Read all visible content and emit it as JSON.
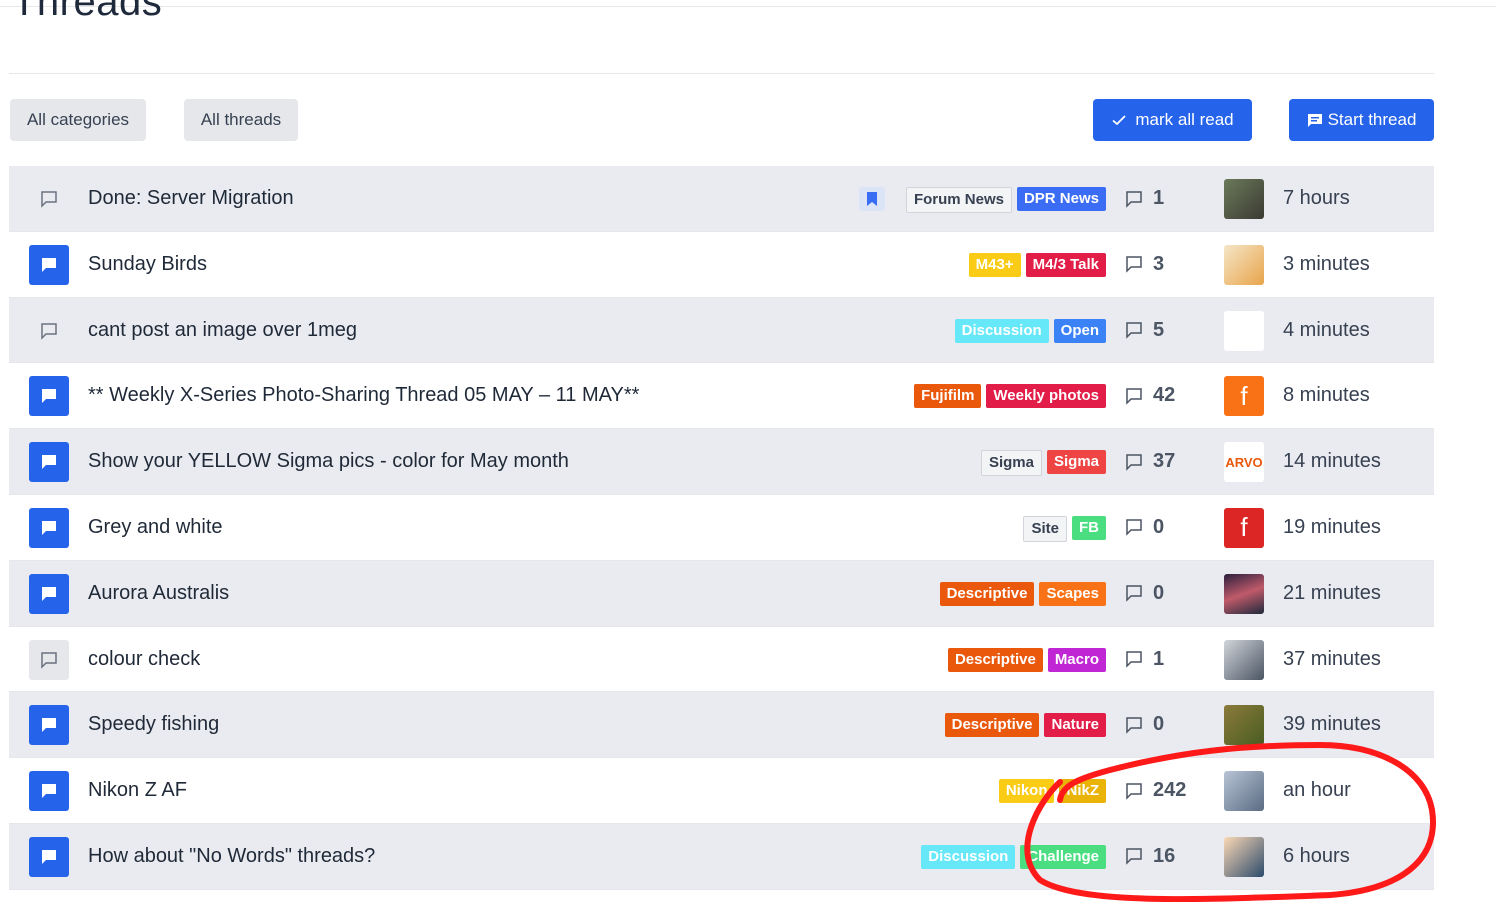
{
  "page": {
    "title": "Threads"
  },
  "toolbar": {
    "all_categories": "All categories",
    "all_threads": "All threads",
    "mark_all_read": "mark all read",
    "start_thread": "Start thread"
  },
  "colors": {
    "accent": "#2563eb",
    "row_alt": "#e9ebf0",
    "annotation": "#ff0000"
  },
  "threads": [
    {
      "title": "Done: Server Migration",
      "icon": "comment-outline-icon",
      "bookmarked": true,
      "tags": [
        {
          "label": "Forum News",
          "bg": "#f3f4f6",
          "fg": "#374151"
        },
        {
          "label": "DPR News",
          "bg": "#3b6cf4",
          "fg": "#ffffff"
        }
      ],
      "replies": "1",
      "avatar": "avatar-photo-man",
      "time": "7 hours"
    },
    {
      "title": "Sunday Birds",
      "icon": "comment-filled-icon",
      "tags": [
        {
          "label": "M43+",
          "bg": "#facc15",
          "fg": "#ffffff"
        },
        {
          "label": "M4/3 Talk",
          "bg": "#e11d48",
          "fg": "#ffffff"
        }
      ],
      "replies": "3",
      "avatar": "avatar-kingfisher",
      "time": "3 minutes"
    },
    {
      "title": "cant post an image over 1meg",
      "icon": "comment-outline-icon",
      "tags": [
        {
          "label": "Discussion",
          "bg": "#67e8f9",
          "fg": "#ffffff"
        },
        {
          "label": "Open",
          "bg": "#3b82f6",
          "fg": "#ffffff"
        }
      ],
      "replies": "5",
      "avatar": "avatar-cartoon-man",
      "time": "4 minutes"
    },
    {
      "title": "** Weekly X-Series Photo-Sharing Thread 05 MAY – 11 MAY**",
      "icon": "comment-filled-icon",
      "tags": [
        {
          "label": "Fujifilm",
          "bg": "#ea580c",
          "fg": "#ffffff"
        },
        {
          "label": "Weekly photos",
          "bg": "#e11d48",
          "fg": "#ffffff"
        }
      ],
      "replies": "42",
      "avatar": "avatar-letter-f-orange",
      "avatar_letter": "f",
      "time": "8 minutes"
    },
    {
      "title": "Show your YELLOW Sigma pics - color for May month",
      "icon": "comment-filled-icon",
      "tags": [
        {
          "label": "Sigma",
          "bg": "#f3f4f6",
          "fg": "#374151"
        },
        {
          "label": "Sigma",
          "bg": "#ef4444",
          "fg": "#ffffff"
        }
      ],
      "replies": "37",
      "avatar": "avatar-arvo",
      "avatar_text": "ARVO",
      "time": "14 minutes"
    },
    {
      "title": "Grey and white",
      "icon": "comment-filled-icon",
      "tags": [
        {
          "label": "Site",
          "bg": "#f3f4f6",
          "fg": "#374151"
        },
        {
          "label": "FB",
          "bg": "#4ade80",
          "fg": "#ffffff"
        }
      ],
      "replies": "0",
      "avatar": "avatar-letter-f-red",
      "avatar_letter": "f",
      "time": "19 minutes"
    },
    {
      "title": "Aurora Australis",
      "icon": "comment-filled-icon",
      "tags": [
        {
          "label": "Descriptive",
          "bg": "#ea580c",
          "fg": "#ffffff"
        },
        {
          "label": "Scapes",
          "bg": "#f97316",
          "fg": "#ffffff"
        }
      ],
      "replies": "0",
      "avatar": "avatar-aurora",
      "time": "21 minutes"
    },
    {
      "title": "colour check",
      "icon": "comment-grey-icon",
      "tags": [
        {
          "label": "Descriptive",
          "bg": "#ea580c",
          "fg": "#ffffff"
        },
        {
          "label": "Macro",
          "bg": "#c026d3",
          "fg": "#ffffff"
        }
      ],
      "replies": "1",
      "avatar": "avatar-insect",
      "time": "37 minutes"
    },
    {
      "title": "Speedy fishing",
      "icon": "comment-filled-icon",
      "tags": [
        {
          "label": "Descriptive",
          "bg": "#ea580c",
          "fg": "#ffffff"
        },
        {
          "label": "Nature",
          "bg": "#e11d48",
          "fg": "#ffffff"
        }
      ],
      "replies": "0",
      "avatar": "avatar-forest",
      "time": "39 minutes"
    },
    {
      "title": "Nikon Z AF",
      "icon": "comment-filled-icon",
      "tags": [
        {
          "label": "Nikon",
          "bg": "#facc15",
          "fg": "#ffffff"
        },
        {
          "label": "NikZ",
          "bg": "#eab308",
          "fg": "#ffffff"
        }
      ],
      "replies": "242",
      "avatar": "avatar-smiling-man",
      "time": "an hour"
    },
    {
      "title": "How about \"No Words\" threads?",
      "icon": "comment-filled-icon",
      "tags": [
        {
          "label": "Discussion",
          "bg": "#67e8f9",
          "fg": "#ffffff"
        },
        {
          "label": "Challenge",
          "bg": "#4ade80",
          "fg": "#ffffff"
        }
      ],
      "replies": "16",
      "avatar": "avatar-camera",
      "time": "6 hours"
    }
  ]
}
